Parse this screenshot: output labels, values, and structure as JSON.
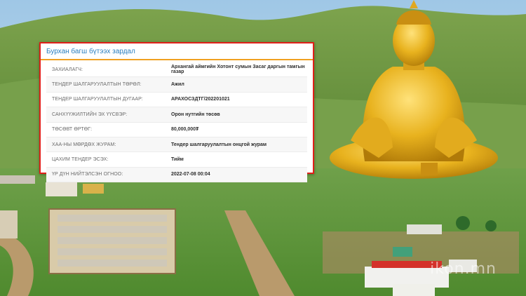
{
  "card": {
    "title": "Бурхан багш бүтээх зардал",
    "rows": [
      {
        "label": "ЗАХИАЛАГЧ:",
        "value": "Архангай аймгийн Хотонт сумын Засаг даргын тамгын газар"
      },
      {
        "label": "ТЕНДЕР ШАЛГАРУУЛАЛТЫН ТӨРӨЛ:",
        "value": "Ажил"
      },
      {
        "label": "ТЕНДЕР ШАЛГАРУУЛАЛТЫН ДУГААР:",
        "value": "АРАХОСЗДТГ/202201021"
      },
      {
        "label": "САНХҮҮЖИЛТИЙН ЭХ ҮҮСВЭР:",
        "value": "Орон нутгийн төсөв"
      },
      {
        "label": "ТӨСӨВТ ӨРТӨГ:",
        "value": "80,000,000₮"
      },
      {
        "label": "ХАА-НЫ МӨРДӨХ ЖУРАМ:",
        "value": "Тендер шалгаруулалтын онцгой журам"
      },
      {
        "label": "ЦАХИМ ТЕНДЕР ЭСЭХ:",
        "value": "Тийм"
      },
      {
        "label": "ҮР ДҮН НИЙТЭЛСЭН ОГНОО:",
        "value": "2022-07-08 00:04"
      }
    ]
  },
  "watermark": "ikon.mn",
  "colors": {
    "accent_border": "#e0201a",
    "header_rule": "#f0a020",
    "title_blue": "#2a7fc0"
  }
}
